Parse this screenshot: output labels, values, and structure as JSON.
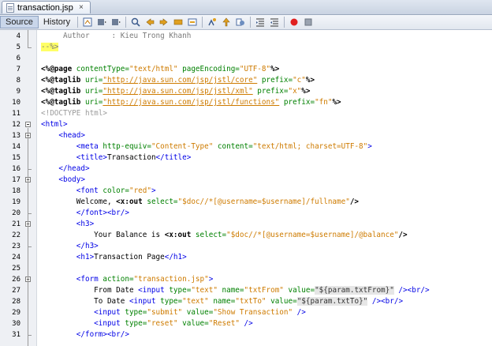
{
  "editor": {
    "file_tab": "transaction.jsp",
    "close_glyph": "×",
    "modes": [
      "Source",
      "History"
    ],
    "toolbar_icons": [
      "last-edit-icon",
      "back-icon",
      "forward-icon",
      "find-icon",
      "find-previous-icon",
      "find-next-icon",
      "find-selection-icon",
      "toggle-highlight-icon",
      "toggle-bookmark-icon",
      "previous-bookmark-icon",
      "next-bookmark-icon",
      "shift-left-icon",
      "shift-right-icon",
      "start-macro-icon",
      "stop-macro-icon"
    ]
  },
  "colors": {
    "attribute": "#008000",
    "value": "#ce7b00",
    "tag": "#0000e6",
    "comment": "#7a7a7a",
    "highlight": "#ffff66",
    "record_red": "#e02020"
  },
  "lines": [
    {
      "n": "4",
      "parts": [
        {
          "t": "     Author     : Kieu Trong Khanh",
          "c": "cm"
        }
      ]
    },
    {
      "n": "5",
      "parts": [
        {
          "t": "--%>",
          "c": "cm",
          "hl": true
        }
      ]
    },
    {
      "n": "6",
      "parts": []
    },
    {
      "n": "7",
      "parts": [
        {
          "t": "<%@",
          "c": "dir"
        },
        {
          "t": "page",
          "c": "dir"
        },
        {
          "t": " contentType=",
          "c": "attr"
        },
        {
          "t": "\"text/html\"",
          "c": "val"
        },
        {
          "t": " pageEncoding=",
          "c": "attr"
        },
        {
          "t": "\"UTF-8\"",
          "c": "val"
        },
        {
          "t": "%>",
          "c": "dir"
        }
      ]
    },
    {
      "n": "8",
      "parts": [
        {
          "t": "<%@",
          "c": "dir"
        },
        {
          "t": "taglib",
          "c": "dir"
        },
        {
          "t": " uri=",
          "c": "attr"
        },
        {
          "t": "\"http://java.sun.com/jsp/jstl/core\"",
          "c": "link"
        },
        {
          "t": " prefix=",
          "c": "attr"
        },
        {
          "t": "\"c\"",
          "c": "val"
        },
        {
          "t": "%>",
          "c": "dir"
        }
      ]
    },
    {
      "n": "9",
      "parts": [
        {
          "t": "<%@",
          "c": "dir"
        },
        {
          "t": "taglib",
          "c": "dir"
        },
        {
          "t": " uri=",
          "c": "attr"
        },
        {
          "t": "\"http://java.sun.com/jsp/jstl/xml\"",
          "c": "link"
        },
        {
          "t": " prefix=",
          "c": "attr"
        },
        {
          "t": "\"x\"",
          "c": "val"
        },
        {
          "t": "%>",
          "c": "dir"
        }
      ]
    },
    {
      "n": "10",
      "parts": [
        {
          "t": "<%@",
          "c": "dir"
        },
        {
          "t": "taglib",
          "c": "dir"
        },
        {
          "t": " uri=",
          "c": "attr"
        },
        {
          "t": "\"http://java.sun.com/jsp/jstl/functions\"",
          "c": "link"
        },
        {
          "t": " prefix=",
          "c": "attr"
        },
        {
          "t": "\"fn\"",
          "c": "val"
        },
        {
          "t": "%>",
          "c": "dir"
        }
      ]
    },
    {
      "n": "11",
      "parts": [
        {
          "t": "<!DOCTYPE html>",
          "c": "doc"
        }
      ]
    },
    {
      "n": "12",
      "parts": [
        {
          "t": "<html>",
          "c": "tag"
        }
      ]
    },
    {
      "n": "13",
      "parts": [
        {
          "t": "    <head>",
          "c": "tag"
        }
      ]
    },
    {
      "n": "14",
      "parts": [
        {
          "t": "        <meta ",
          "c": "tag"
        },
        {
          "t": "http-equiv=",
          "c": "attr"
        },
        {
          "t": "\"Content-Type\"",
          "c": "val"
        },
        {
          "t": " content=",
          "c": "attr"
        },
        {
          "t": "\"text/html; charset=UTF-8\"",
          "c": "val"
        },
        {
          "t": ">",
          "c": "tag"
        }
      ]
    },
    {
      "n": "15",
      "parts": [
        {
          "t": "        <title>",
          "c": "tag"
        },
        {
          "t": "Transaction",
          "c": "plain"
        },
        {
          "t": "</title>",
          "c": "tag"
        }
      ]
    },
    {
      "n": "16",
      "parts": [
        {
          "t": "    </head>",
          "c": "tag"
        }
      ]
    },
    {
      "n": "17",
      "parts": [
        {
          "t": "    <body>",
          "c": "tag"
        }
      ]
    },
    {
      "n": "18",
      "parts": [
        {
          "t": "        <font ",
          "c": "tag"
        },
        {
          "t": "color=",
          "c": "attr"
        },
        {
          "t": "\"red\"",
          "c": "val"
        },
        {
          "t": ">",
          "c": "tag"
        }
      ]
    },
    {
      "n": "19",
      "parts": [
        {
          "t": "        Welcome, ",
          "c": "plain"
        },
        {
          "t": "<x:out",
          "c": "el"
        },
        {
          "t": " select=",
          "c": "attr"
        },
        {
          "t": "\"$doc//*[@username=$username]/fullname\"",
          "c": "xp"
        },
        {
          "t": "/>",
          "c": "el"
        }
      ]
    },
    {
      "n": "20",
      "parts": [
        {
          "t": "        </font><br/>",
          "c": "tag"
        }
      ]
    },
    {
      "n": "21",
      "parts": [
        {
          "t": "        <h3>",
          "c": "tag"
        }
      ]
    },
    {
      "n": "22",
      "parts": [
        {
          "t": "            Your Balance is ",
          "c": "plain"
        },
        {
          "t": "<x:out",
          "c": "el"
        },
        {
          "t": " select=",
          "c": "attr"
        },
        {
          "t": "\"$doc//*[@username=$username]/@balance\"",
          "c": "xp"
        },
        {
          "t": "/>",
          "c": "el"
        }
      ]
    },
    {
      "n": "23",
      "parts": [
        {
          "t": "        </h3>",
          "c": "tag"
        }
      ]
    },
    {
      "n": "24",
      "parts": [
        {
          "t": "        <h1>",
          "c": "tag"
        },
        {
          "t": "Transaction Page",
          "c": "plain"
        },
        {
          "t": "</h1>",
          "c": "tag"
        }
      ]
    },
    {
      "n": "25",
      "parts": []
    },
    {
      "n": "26",
      "parts": [
        {
          "t": "        <form ",
          "c": "tag"
        },
        {
          "t": "action=",
          "c": "attr"
        },
        {
          "t": "\"transaction.jsp\"",
          "c": "val"
        },
        {
          "t": ">",
          "c": "tag"
        }
      ]
    },
    {
      "n": "27",
      "parts": [
        {
          "t": "            From Date ",
          "c": "plain"
        },
        {
          "t": "<input ",
          "c": "tag"
        },
        {
          "t": "type=",
          "c": "attr"
        },
        {
          "t": "\"text\"",
          "c": "val"
        },
        {
          "t": " name=",
          "c": "attr"
        },
        {
          "t": "\"txtFrom\"",
          "c": "val"
        },
        {
          "t": " value=",
          "c": "attr"
        },
        {
          "t": "\"${param.txtFrom}\"",
          "c": "eld"
        },
        {
          "t": " />",
          "c": "tag"
        },
        {
          "t": "<br/>",
          "c": "tag"
        }
      ]
    },
    {
      "n": "28",
      "parts": [
        {
          "t": "            To Date ",
          "c": "plain"
        },
        {
          "t": "<input ",
          "c": "tag"
        },
        {
          "t": "type=",
          "c": "attr"
        },
        {
          "t": "\"text\"",
          "c": "val"
        },
        {
          "t": " name=",
          "c": "attr"
        },
        {
          "t": "\"txtTo\"",
          "c": "val"
        },
        {
          "t": " value=",
          "c": "attr"
        },
        {
          "t": "\"${param.txtTo}\"",
          "c": "eld"
        },
        {
          "t": " />",
          "c": "tag"
        },
        {
          "t": "<br/>",
          "c": "tag"
        }
      ]
    },
    {
      "n": "29",
      "parts": [
        {
          "t": "            <input ",
          "c": "tag"
        },
        {
          "t": "type=",
          "c": "attr"
        },
        {
          "t": "\"submit\"",
          "c": "val"
        },
        {
          "t": " value=",
          "c": "attr"
        },
        {
          "t": "\"Show Transaction\"",
          "c": "val"
        },
        {
          "t": " />",
          "c": "tag"
        }
      ]
    },
    {
      "n": "30",
      "parts": [
        {
          "t": "            <input ",
          "c": "tag"
        },
        {
          "t": "type=",
          "c": "attr"
        },
        {
          "t": "\"reset\"",
          "c": "val"
        },
        {
          "t": " value=",
          "c": "attr"
        },
        {
          "t": "\"Reset\"",
          "c": "val"
        },
        {
          "t": " />",
          "c": "tag"
        }
      ]
    },
    {
      "n": "31",
      "parts": [
        {
          "t": "        </form><br/>",
          "c": "tag"
        }
      ]
    }
  ]
}
